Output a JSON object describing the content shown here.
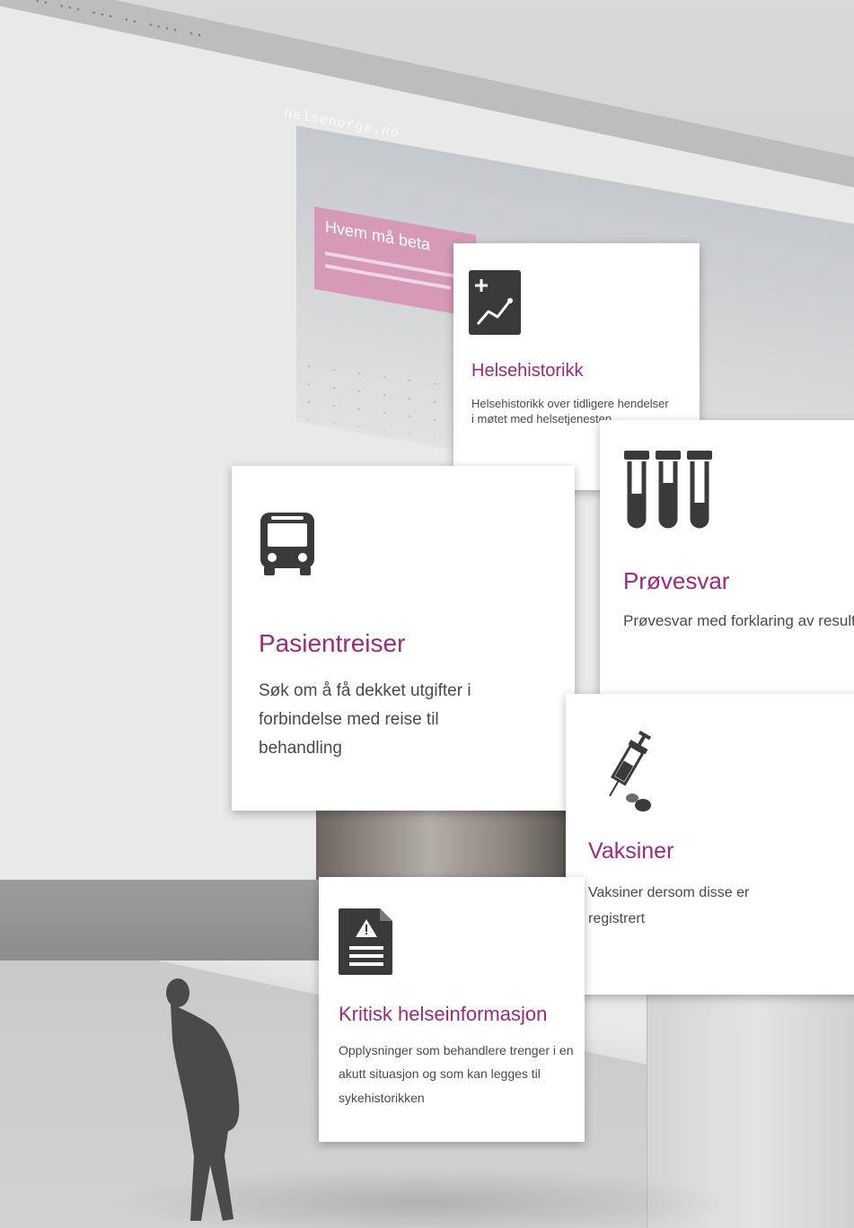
{
  "site": {
    "logo": "helsenorge.no",
    "nav": [
      "",
      ""
    ],
    "hero_title": "Hvem må beta",
    "hero_arrow": "‹"
  },
  "cards": {
    "helsehistorikk": {
      "icon": "line-chart-plus-icon",
      "title": "Helsehistorikk",
      "description": "Helsehistorikk over tidligere hendelser i møtet med helsetjenesten"
    },
    "provesvar": {
      "icon": "test-tubes-icon",
      "title": "Prøvesvar",
      "description": "Prøvesvar med forklaring av resultatet"
    },
    "pasientreiser": {
      "icon": "bus-icon",
      "title": "Pasientreiser",
      "description": "Søk om å få dekket utgifter i forbindelse med reise til behandling"
    },
    "vaksiner": {
      "icon": "syringe-icon",
      "title": "Vaksiner",
      "description": "Vaksiner dersom disse er registrert"
    },
    "kritisk": {
      "icon": "warning-document-icon",
      "title": "Kritisk helseinformasjon",
      "description": "Opplysninger som behandlere trenger i en akutt situasjon og som kan legges til sykehistorikken"
    }
  },
  "colors": {
    "accent": "#9b2a7d",
    "icon": "#3a3a3a",
    "background": "#cfcfcf"
  }
}
